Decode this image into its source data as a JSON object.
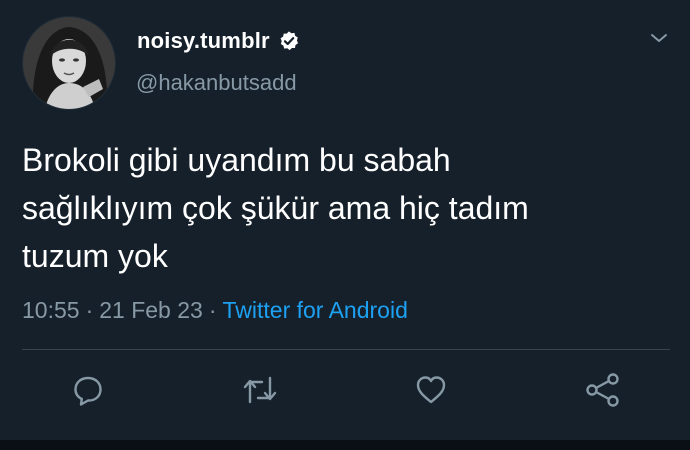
{
  "tweet": {
    "display_name": "noisy.tumblr",
    "handle": "@hakanbutsadd",
    "verified": true,
    "text_lines": [
      "Brokoli gibi uyandım bu sabah",
      "sağlıklıyım çok şükür ama hiç tadım",
      "tuzum yok"
    ],
    "time": "10:55",
    "date": "21 Feb 23",
    "separator": "·",
    "source": "Twitter for Android"
  },
  "icons": {
    "verified": "verified-badge-icon",
    "menu": "chevron-down-icon",
    "reply": "reply-icon",
    "retweet": "retweet-icon",
    "like": "heart-icon",
    "share": "share-icon"
  },
  "colors": {
    "background": "#15202b",
    "text": "#ffffff",
    "muted": "#8899a6",
    "link": "#1da1f2",
    "divider": "#38444d"
  }
}
